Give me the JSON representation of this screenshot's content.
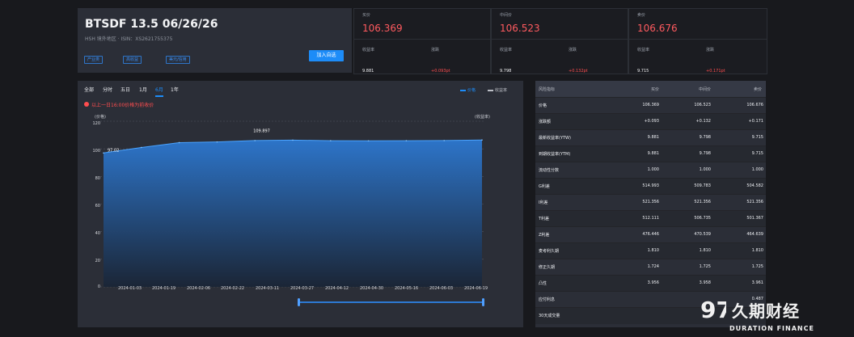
{
  "header": {
    "title": "BTSDF 13.5 06/26/26",
    "subtitle": "HSH 境外地区 · ISIN：XS2621755375",
    "tags": [
      "产业类",
      "高收益",
      "美元/信用"
    ],
    "watchlist_button": "加入自选"
  },
  "quotes": [
    {
      "title": "买价",
      "price": "106.369",
      "yield_label": "收益率",
      "change_label": "涨跌",
      "yield_value": "9.881",
      "change_value": "+0.093pt"
    },
    {
      "title": "中间价",
      "price": "106.523",
      "yield_label": "收益率",
      "change_label": "涨跌",
      "yield_value": "9.798",
      "change_value": "+0.132pt"
    },
    {
      "title": "卖价",
      "price": "106.676",
      "yield_label": "收益率",
      "change_label": "涨跌",
      "yield_value": "9.715",
      "change_value": "+0.171pt"
    }
  ],
  "chart_controls": {
    "ranges": [
      "全部",
      "分时",
      "五日",
      "1月",
      "6月",
      "1年"
    ],
    "active": "6月",
    "legend": [
      "价格",
      "收益率"
    ],
    "note": "以上一日16:00价格为前收价",
    "left_axis_label": "(价格)",
    "right_axis_label": "(收益率)"
  },
  "chart_data": {
    "type": "area",
    "x": [
      "2024-01-03",
      "2024-01-19",
      "2024-02-06",
      "2024-02-22",
      "2024-03-11",
      "2024-03-27",
      "2024-04-12",
      "2024-04-30",
      "2024-05-16",
      "2024-06-03",
      "2024-06-19"
    ],
    "series": [
      {
        "name": "价格",
        "values": [
          97.02,
          101.0,
          104.5,
          105.0,
          106.0,
          106.3,
          105.9,
          105.8,
          105.9,
          106.0,
          106.4
        ]
      }
    ],
    "ylim": [
      0,
      120
    ],
    "annotations": [
      "97.02",
      "109.897"
    ]
  },
  "table": {
    "headers": [
      "风险指标",
      "买价",
      "中间价",
      "卖价"
    ],
    "rows": [
      {
        "label": "价格",
        "bid": "106.369",
        "mid": "106.523",
        "ask": "106.676"
      },
      {
        "label": "涨跌额",
        "bid": "+0.093",
        "mid": "+0.132",
        "ask": "+0.171"
      },
      {
        "label": "最新收益率(YTW)",
        "bid": "9.881",
        "mid": "9.798",
        "ask": "9.715"
      },
      {
        "label": "到期收益率(YTM)",
        "bid": "9.881",
        "mid": "9.798",
        "ask": "9.715"
      },
      {
        "label": "流动性分数",
        "bid": "1.000",
        "mid": "1.000",
        "ask": "1.000"
      },
      {
        "label": "G利差",
        "bid": "514.993",
        "mid": "509.783",
        "ask": "504.582"
      },
      {
        "label": "I利差",
        "bid": "521.356",
        "mid": "521.356",
        "ask": "521.356"
      },
      {
        "label": "T利差",
        "bid": "512.111",
        "mid": "506.735",
        "ask": "501.367"
      },
      {
        "label": "Z利差",
        "bid": "476.446",
        "mid": "470.539",
        "ask": "464.639"
      },
      {
        "label": "麦考利久期",
        "bid": "1.810",
        "mid": "1.810",
        "ask": "1.810"
      },
      {
        "label": "修正久期",
        "bid": "1.724",
        "mid": "1.725",
        "ask": "1.725"
      },
      {
        "label": "凸性",
        "bid": "3.956",
        "mid": "3.958",
        "ask": "3.961"
      },
      {
        "label": "应付利息",
        "bid": "",
        "mid": "",
        "ask": "0.487"
      },
      {
        "label": "30天成交量",
        "bid": "",
        "mid": "",
        "ask": ""
      }
    ]
  },
  "watermark": {
    "logo": "97",
    "brand": "久期财经",
    "brand_en": "DURATION FINANCE"
  }
}
